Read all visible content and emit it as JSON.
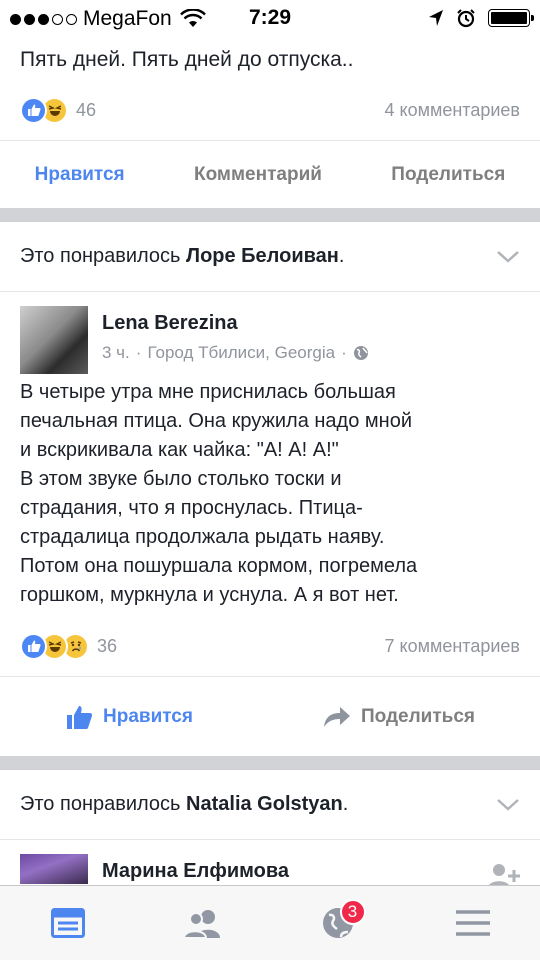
{
  "status": {
    "carrier": "MegaFon",
    "time": "7:29"
  },
  "post1": {
    "text_cut": "Пять дней. Пять дней до отпуска..",
    "reactions": {
      "icons": [
        "like",
        "haha"
      ],
      "count": "46"
    },
    "comments": "4 комментариев",
    "actions": {
      "like": "Нравится",
      "comment": "Комментарий",
      "share": "Поделиться"
    }
  },
  "post2": {
    "liked_prefix": "Это понравилось ",
    "liked_name": "Лоре Белоиван",
    "liked_suffix": ".",
    "author": "Lena Berezina",
    "meta_time": "3 ч.",
    "meta_sep": "·",
    "meta_place": "Город Тбилиси, Georgia",
    "text": "В четыре утра мне приснилась большая\nпечальная птица. Она кружила надо мной\nи вскрикивала как чайка: \"А! А! А!\"\nВ этом звуке было столько тоски и\nстрадания, что я проснулась. Птица-\nстрадалица продолжала рыдать наяву.\nПотом она пошуршала кормом, погремела\nгоршком, муркнула и уснула. А я вот нет.",
    "reactions": {
      "icons": [
        "like",
        "haha",
        "sad"
      ],
      "count": "36"
    },
    "comments": "7 комментариев",
    "actions": {
      "like": "Нравится",
      "share": "Поделиться"
    }
  },
  "post3": {
    "liked_prefix": "Это понравилось ",
    "liked_name": "Natalia Golstyan",
    "liked_suffix": ".",
    "author": "Марина Елфимова"
  },
  "tabbar": {
    "notifications_badge": "3"
  },
  "colors": {
    "accent": "#4e86f0",
    "divider": "#d1d3d7",
    "badge": "#f02849"
  }
}
